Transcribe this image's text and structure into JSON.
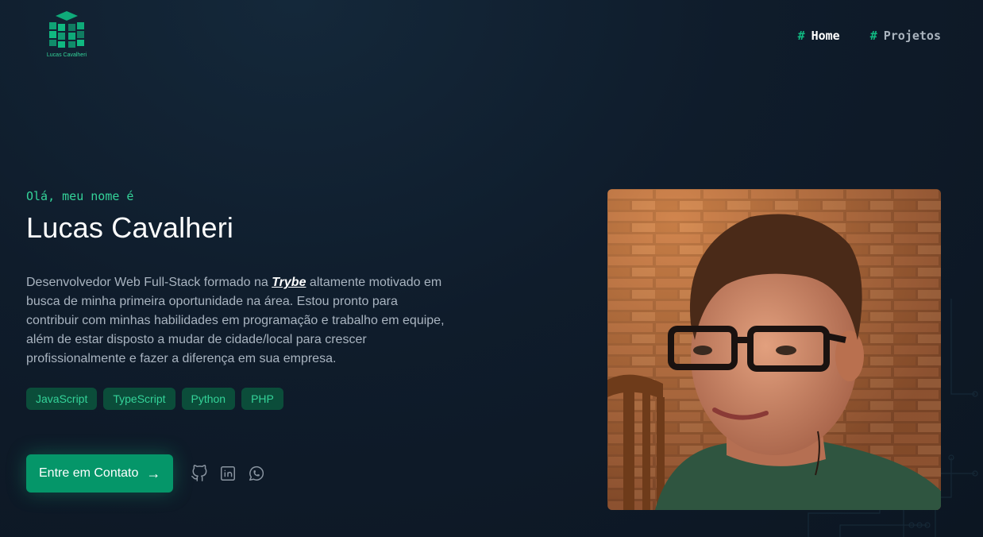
{
  "header": {
    "logo_text": "Lucas Cavalheri",
    "nav": [
      {
        "hash": "#",
        "label": "Home",
        "active": true
      },
      {
        "hash": "#",
        "label": "Projetos",
        "active": false
      }
    ]
  },
  "hero": {
    "greeting": "Olá, meu nome é",
    "name": "Lucas Cavalheri",
    "description_before": "Desenvolvedor Web Full-Stack formado na ",
    "description_brand": "Trybe",
    "description_after": " altamente motivado em busca de minha primeira oportunidade na área. Estou pronto para contribuir com minhas habilidades em programação e trabalho em equipe, além de estar disposto a mudar de cidade/local para crescer profissionalmente e fazer a diferença em sua empresa.",
    "tags": [
      "JavaScript",
      "TypeScript",
      "Python",
      "PHP"
    ],
    "cta_label": "Entre em Contato",
    "cta_icon": "arrow-right-icon",
    "socials": [
      "github-icon",
      "linkedin-icon",
      "whatsapp-icon"
    ]
  },
  "colors": {
    "accent": "#10b981",
    "accent_light": "#34d399",
    "background": "#0f1c2b",
    "tag_bg": "#0b4d3a"
  }
}
